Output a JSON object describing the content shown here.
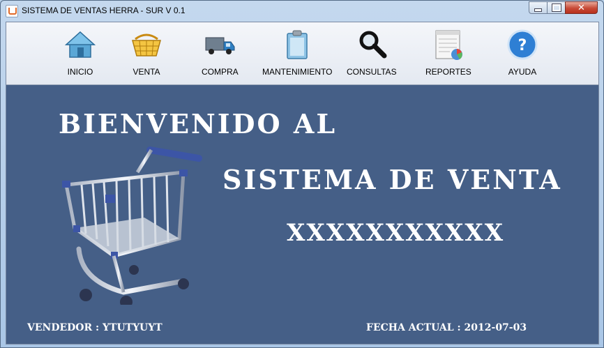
{
  "window": {
    "title": "SISTEMA DE VENTAS HERRA - SUR V 0.1",
    "controls": {
      "minimize": "–",
      "maximize": "□",
      "close": "✕"
    }
  },
  "toolbar": {
    "items": [
      {
        "label": "INICIO",
        "icon": "home-icon"
      },
      {
        "label": "VENTA",
        "icon": "basket-icon"
      },
      {
        "label": "COMPRA",
        "icon": "truck-icon"
      },
      {
        "label": "MANTENIMIENTO",
        "icon": "clipboard-icon"
      },
      {
        "label": "CONSULTAS",
        "icon": "magnifier-icon"
      },
      {
        "label": "REPORTES",
        "icon": "report-chart-icon"
      },
      {
        "label": "AYUDA",
        "icon": "help-icon"
      }
    ]
  },
  "welcome": {
    "line1": "BIENVENIDO AL",
    "line2": "SISTEMA DE VENTA",
    "line3": "XXXXXXXXXXX"
  },
  "footer": {
    "vendedor": "VENDEDOR : YTUTYUYT",
    "fecha": "FECHA ACTUAL : 2012-07-03"
  },
  "colors": {
    "background": "#455f87",
    "text": "#ffffff"
  }
}
